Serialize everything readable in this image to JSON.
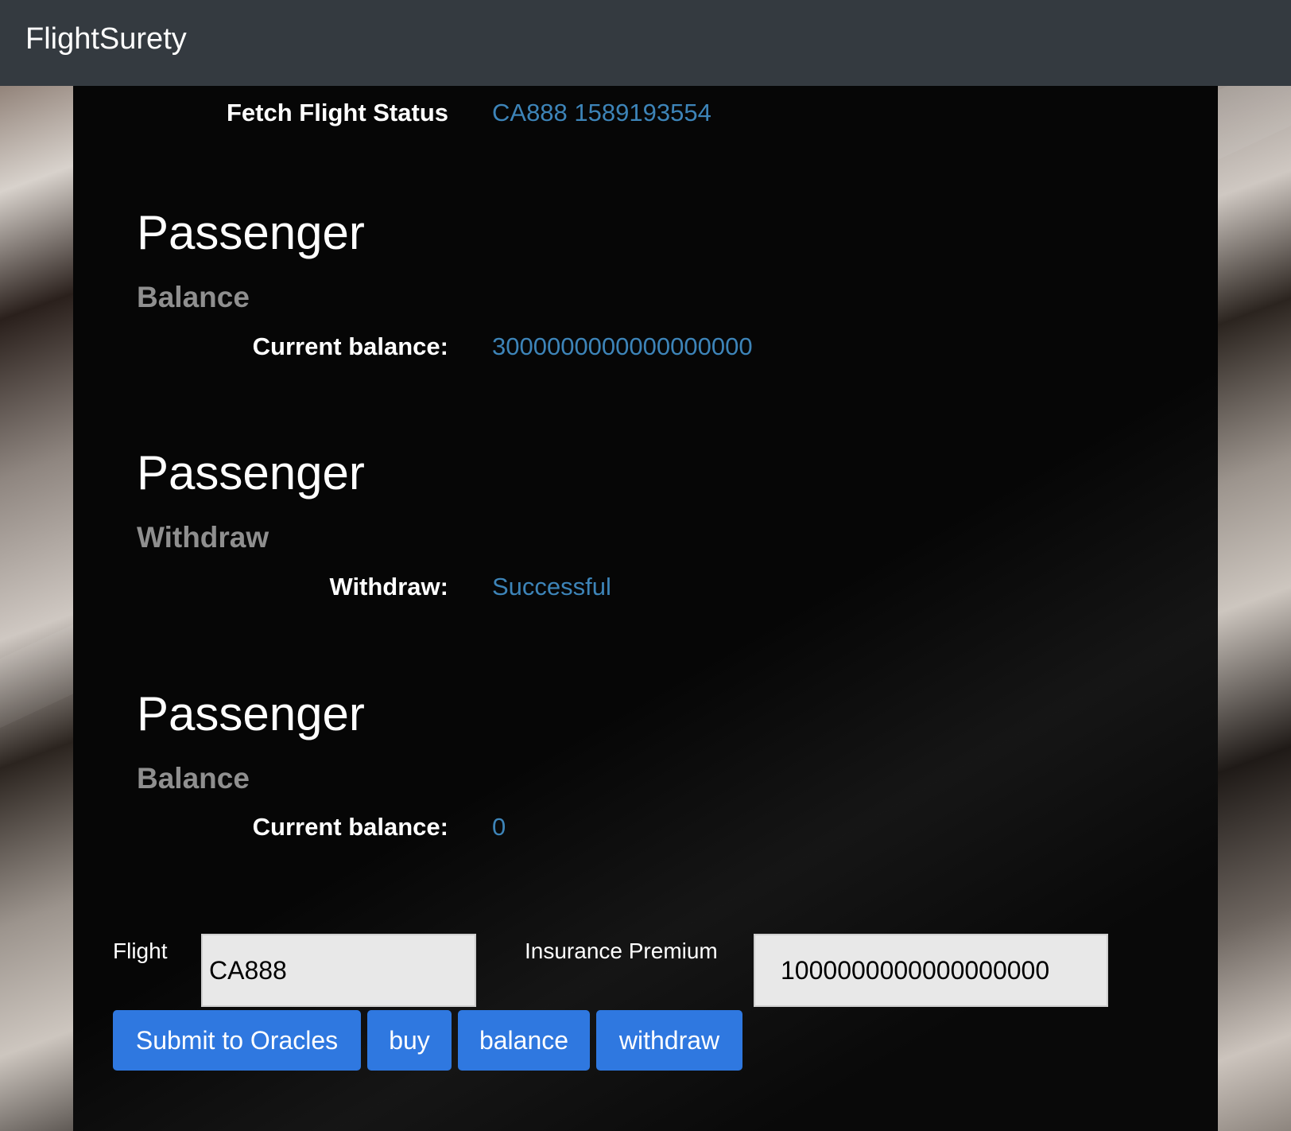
{
  "navbar": {
    "brand": "FlightSurety"
  },
  "fetch_status": {
    "label": "Fetch Flight Status",
    "value": "CA888 1589193554"
  },
  "sections": [
    {
      "title": "Passenger",
      "subtitle": "Balance",
      "label": "Current balance:",
      "value": "3000000000000000000"
    },
    {
      "title": "Passenger",
      "subtitle": "Withdraw",
      "label": "Withdraw:",
      "value": "Successful"
    },
    {
      "title": "Passenger",
      "subtitle": "Balance",
      "label": "Current balance:",
      "value": "0"
    }
  ],
  "form": {
    "flight_label": "Flight",
    "flight_value": "CA888",
    "premium_label": "Insurance Premium",
    "premium_value": "1000000000000000000"
  },
  "buttons": {
    "submit": "Submit to Oracles",
    "buy": "buy",
    "balance": "balance",
    "withdraw": "withdraw"
  },
  "colors": {
    "navbar": "#343a40",
    "value_text": "#3d84b8",
    "button": "#2f78e0",
    "subtitle": "#8f8f8f"
  }
}
